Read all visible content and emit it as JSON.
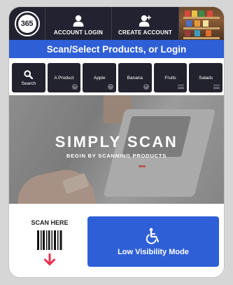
{
  "header": {
    "logo_text": "365",
    "account_login_label": "ACCOUNT LOGIN",
    "create_account_label": "CREATE ACCOUNT"
  },
  "banner": {
    "text": "Scan/Select Products, or Login"
  },
  "categories": [
    {
      "label": "Search",
      "icon": "search-icon"
    },
    {
      "label": "A Product",
      "icon": "plus-badge-icon"
    },
    {
      "label": "Apple",
      "icon": "minus-badge-icon"
    },
    {
      "label": "Banana",
      "icon": "plus-badge-icon"
    },
    {
      "label": "Fruits",
      "icon": "list-icon"
    },
    {
      "label": "Salads",
      "icon": "list-icon"
    }
  ],
  "hero": {
    "title": "SIMPLY SCAN",
    "subtitle": "BEGIN BY SCANNING PRODUCTS"
  },
  "scan_here": {
    "label": "SCAN HERE"
  },
  "low_visibility": {
    "label": "Low Visibility Mode",
    "icon": "wheelchair-icon"
  },
  "colors": {
    "dark_bar": "#222230",
    "accent_blue": "#2e5fd6",
    "arrow_red": "#e8304b"
  }
}
